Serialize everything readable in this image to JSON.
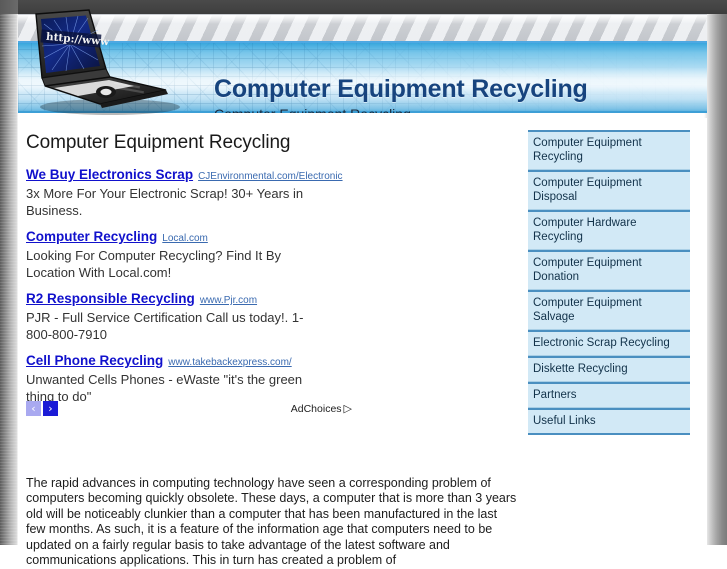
{
  "site": {
    "title": "Computer Equipment Recycling",
    "tagline": "Computer Equipment Recycling",
    "logo_screen_text": "http://www"
  },
  "main": {
    "page_heading": "Computer Equipment Recycling",
    "article_paragraph": "The rapid advances in computing technology have seen a corresponding problem of computers becoming quickly obsolete. These days, a computer that is more than 3 years old will be noticeably clunkier than a computer that has been manufactured in the last few months. As such, it is a feature of the information age that computers need to be updated on a fairly regular basis to take advantage of the latest software and communications applications. This in turn has created a problem of"
  },
  "ads": {
    "items": [
      {
        "headline": "We Buy Electronics Scrap",
        "url": "CJEnvironmental.com/Electronic",
        "description": "3x More For Your Electronic Scrap! 30+ Years in Business."
      },
      {
        "headline": "Computer Recycling",
        "url": "Local.com",
        "description": "Looking For Computer Recycling? Find It By Location With Local.com!"
      },
      {
        "headline": "R2 Responsible Recycling",
        "url": "www.Pjr.com",
        "description": "PJR - Full Service Certification Call us today!. 1-800-800-7910"
      },
      {
        "headline": "Cell Phone Recycling",
        "url": "www.takebackexpress.com/",
        "description": "Unwanted Cells Phones - eWaste \"it's the green thing to do\""
      }
    ],
    "prev_arrow": "‹",
    "next_arrow": "›",
    "adchoices_label": "AdChoices",
    "adchoices_icon": "▷"
  },
  "sidebar": {
    "items": [
      {
        "label": "Computer Equipment Recycling"
      },
      {
        "label": "Computer Equipment Disposal"
      },
      {
        "label": "Computer Hardware Recycling"
      },
      {
        "label": "Computer Equipment Donation"
      },
      {
        "label": "Computer Equipment Salvage"
      },
      {
        "label": "Electronic Scrap Recycling"
      },
      {
        "label": "Diskette Recycling"
      },
      {
        "label": "Partners"
      },
      {
        "label": "Useful Links"
      }
    ]
  },
  "colors": {
    "link_blue": "#1111cc",
    "title_blue": "#17447e",
    "sidebar_bg": "#d2e9f6",
    "sidebar_border": "#4a8fc0",
    "banner_blue": "#79c6ea"
  }
}
